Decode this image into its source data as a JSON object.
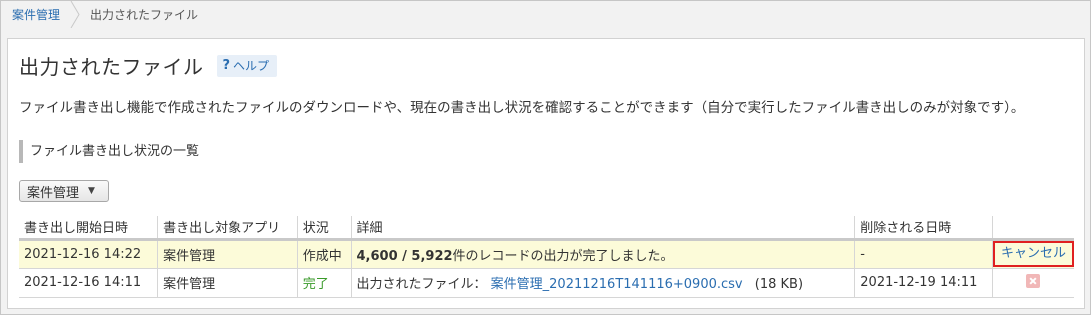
{
  "breadcrumb": {
    "root": "案件管理",
    "current": "出力されたファイル"
  },
  "page": {
    "title": "出力されたファイル",
    "help_label": "ヘルプ",
    "description": "ファイル書き出し機能で作成されたファイルのダウンロードや、現在の書き出し状況を確認することができます（自分で実行したファイル書き出しのみが対象です）。"
  },
  "section": {
    "heading": "ファイル書き出し状況の一覧"
  },
  "filter": {
    "selected": "案件管理"
  },
  "table": {
    "headers": [
      "書き出し開始日時",
      "書き出し対象アプリ",
      "状況",
      "詳細",
      "削除される日時",
      ""
    ],
    "rows": [
      {
        "started": "2021-12-16 14:22",
        "app": "案件管理",
        "status": "作成中",
        "detail_count": "4,600 / 5,922",
        "detail_text": "件のレコードの出力が完了しました。",
        "delete_at": "-",
        "action": "キャンセル"
      },
      {
        "started": "2021-12-16 14:11",
        "app": "案件管理",
        "status": "完了",
        "detail_prefix": "出力されたファイル：",
        "file_name": "案件管理_20211216T141116+0900.csv",
        "file_size": "(18 KB)",
        "delete_at": "2021-12-19 14:11",
        "action_icon": "delete-icon"
      }
    ]
  },
  "colors": {
    "link": "#2a6db0",
    "done": "#3a9a2a",
    "highlight_row": "#fcfbd9",
    "focus_border": "#e02020"
  }
}
